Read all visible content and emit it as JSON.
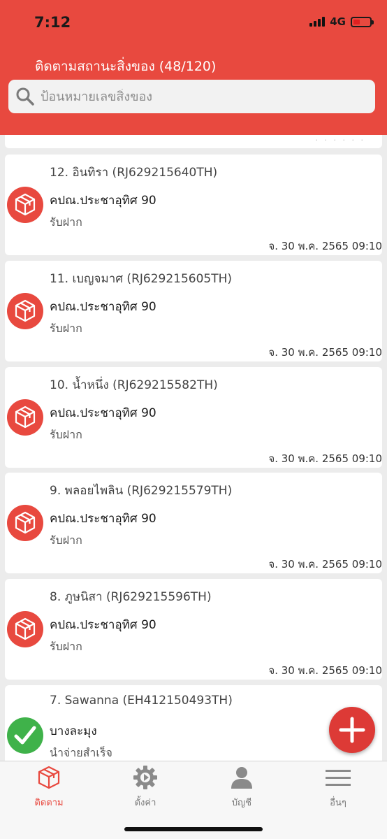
{
  "status_bar": {
    "time": "7:12",
    "network": "4G"
  },
  "header": {
    "title": "ติดตามสถานะสิ่งของ (48/120)"
  },
  "search": {
    "placeholder": "ป้อนหมายเลขสิ่งของ"
  },
  "items": [
    {
      "title": "12. อินทิรา (RJ629215640TH)",
      "location": "คปณ.ประชาอุทิศ 90",
      "status": "รับฝาก",
      "date": "จ. 30 พ.ค. 2565 09:10",
      "icon": "package-icon"
    },
    {
      "title": "11. เบญจมาศ (RJ629215605TH)",
      "location": "คปณ.ประชาอุทิศ 90",
      "status": "รับฝาก",
      "date": "จ. 30 พ.ค. 2565 09:10",
      "icon": "package-icon"
    },
    {
      "title": "10. น้ำหนึ่ง (RJ629215582TH)",
      "location": "คปณ.ประชาอุทิศ 90",
      "status": "รับฝาก",
      "date": "จ. 30 พ.ค. 2565 09:10",
      "icon": "package-icon"
    },
    {
      "title": "9. พลอยไพลิน (RJ629215579TH)",
      "location": "คปณ.ประชาอุทิศ 90",
      "status": "รับฝาก",
      "date": "จ. 30 พ.ค. 2565 09:10",
      "icon": "package-icon"
    },
    {
      "title": "8. ภูษนิสา (RJ629215596TH)",
      "location": "คปณ.ประชาอุทิศ 90",
      "status": "รับฝาก",
      "date": "จ. 30 พ.ค. 2565 09:10",
      "icon": "package-icon"
    },
    {
      "title": "7. Sawanna (EH412150493TH)",
      "location": "บางละมุง",
      "status": "นำจ่ายสำเร็จ",
      "date": "",
      "icon": "check-icon"
    }
  ],
  "tabs": [
    {
      "label": "ติดตาม",
      "icon": "package-tab-icon",
      "active": true
    },
    {
      "label": "ตั้งค่า",
      "icon": "gear-icon",
      "active": false
    },
    {
      "label": "บัญชี",
      "icon": "user-icon",
      "active": false
    },
    {
      "label": "อื่นๆ",
      "icon": "menu-icon",
      "active": false
    }
  ],
  "colors": {
    "primary": "#e8493f",
    "success": "#3fb24a",
    "background": "#ececec"
  }
}
